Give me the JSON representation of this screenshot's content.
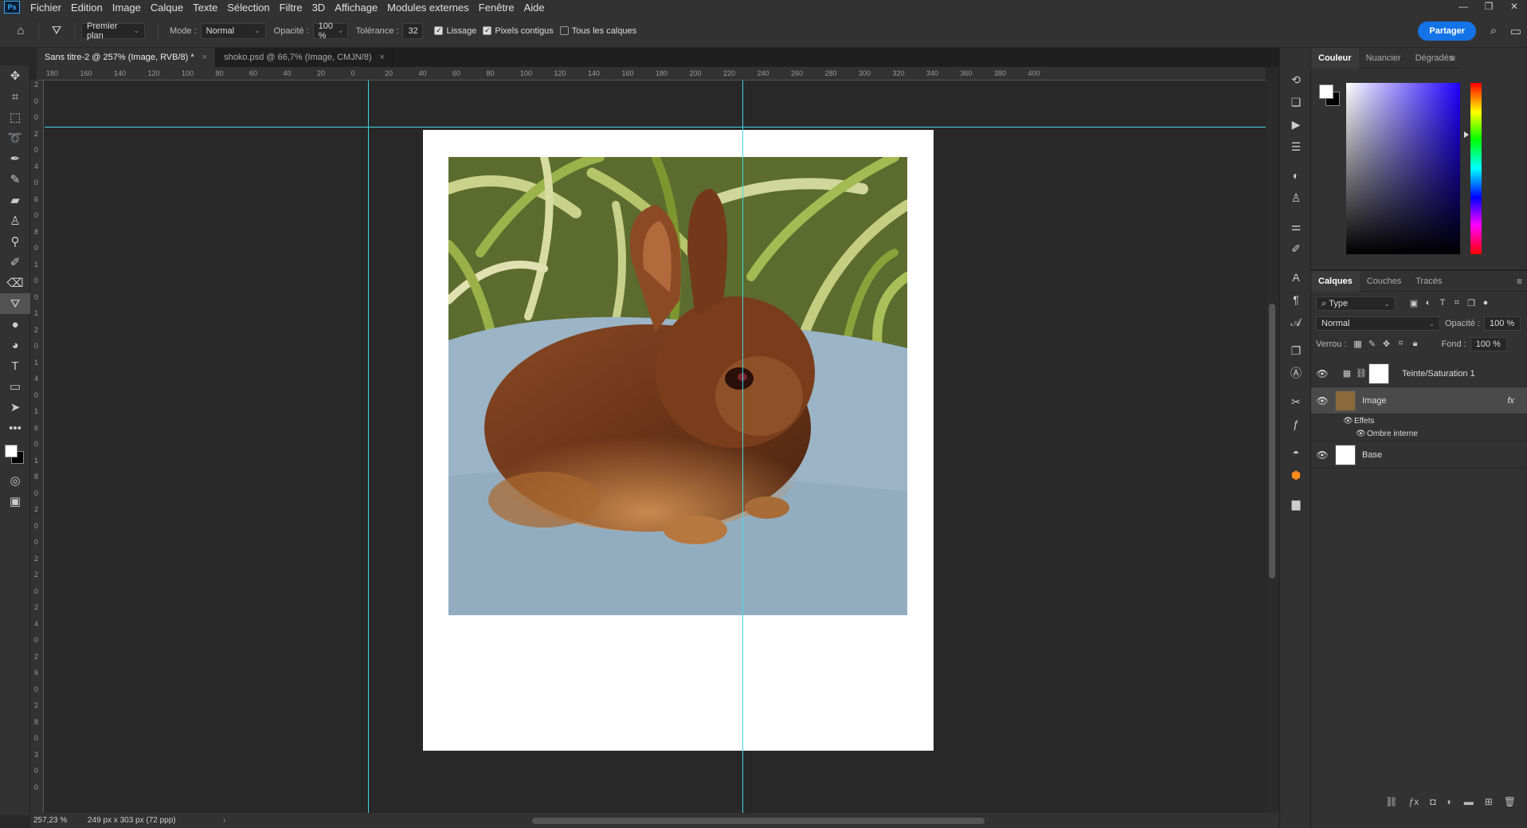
{
  "menu": {
    "logo": "Ps",
    "items": [
      "Fichier",
      "Edition",
      "Image",
      "Calque",
      "Texte",
      "Sélection",
      "Filtre",
      "3D",
      "Affichage",
      "Modules externes",
      "Fenêtre",
      "Aide"
    ]
  },
  "options": {
    "fill_source": "Premier plan",
    "mode_label": "Mode :",
    "mode_value": "Normal",
    "opacity_label": "Opacité :",
    "opacity_value": "100 %",
    "tolerance_label": "Tolérance :",
    "tolerance_value": "32",
    "lissage": "Lissage",
    "pixels_contigus": "Pixels contigus",
    "tous_calques": "Tous les calques",
    "share": "Partager"
  },
  "tabs": [
    {
      "label": "Sans titre-2 @ 257% (Image, RVB/8) *"
    },
    {
      "label": "shoko.psd @ 66,7% (Image, CMJN/8)"
    }
  ],
  "ruler": {
    "h_ticks": [
      "180",
      "160",
      "140",
      "120",
      "100",
      "80",
      "60",
      "40",
      "20",
      "0",
      "20",
      "40",
      "60",
      "80",
      "100",
      "120",
      "140",
      "160",
      "180",
      "200",
      "220",
      "240",
      "260",
      "280",
      "300",
      "320",
      "340",
      "360",
      "380",
      "400"
    ],
    "v_ticks": [
      "2",
      "0",
      "0",
      "2",
      "0",
      "4",
      "0",
      "6",
      "0",
      "8",
      "0",
      "1",
      "0",
      "0",
      "1",
      "2",
      "0",
      "1",
      "4",
      "0",
      "1",
      "6",
      "0",
      "1",
      "8",
      "0",
      "2",
      "0",
      "0",
      "2",
      "2",
      "0",
      "2",
      "4",
      "0",
      "2",
      "6",
      "0",
      "2",
      "8",
      "0",
      "3",
      "0",
      "0"
    ]
  },
  "status": {
    "zoom": "257,23 %",
    "doc_info": "249 px x 303 px (72 ppp)"
  },
  "color_panel": {
    "tabs": [
      "Couleur",
      "Nuancier",
      "Dégradés"
    ]
  },
  "layers_panel": {
    "tabs": [
      "Calques",
      "Couches",
      "Tracés"
    ],
    "filter": "Type",
    "blend": "Normal",
    "opacity_label": "Opacité :",
    "opacity_value": "100 %",
    "lock_label": "Verrou :",
    "fill_label": "Fond :",
    "fill_value": "100 %",
    "layers": [
      {
        "name": "Teinte/Saturation 1"
      },
      {
        "name": "Image",
        "fx": "fx"
      },
      {
        "name": "Base"
      }
    ],
    "effects_label": "Effets",
    "effect_item": "Ombre interne"
  },
  "colors": {
    "accent": "#1473e6",
    "guide": "#40d8e8",
    "panel": "#323232",
    "canvas": "#282828"
  }
}
